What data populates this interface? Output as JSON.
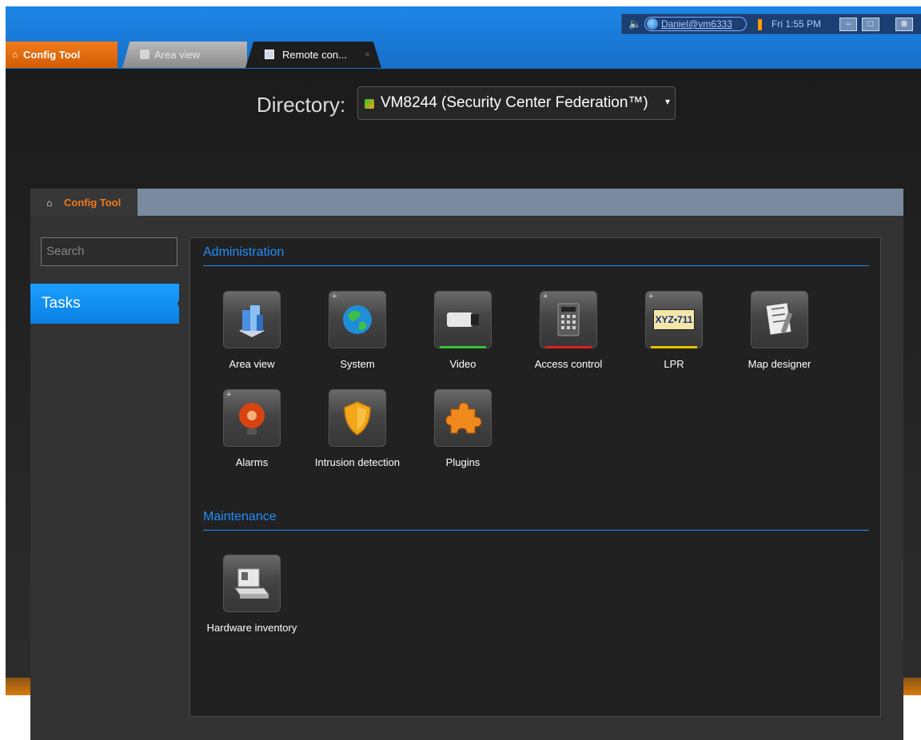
{
  "system_tray": {
    "user": "Daniel@vm6333",
    "time": "Fri 1:55 PM",
    "minimize": "–",
    "maximize": "□",
    "close": "⊗"
  },
  "tabs": [
    {
      "label": "Config Tool"
    },
    {
      "label": "Area view"
    },
    {
      "label": "Remote con...",
      "close": "×"
    }
  ],
  "directory": {
    "label": "Directory:",
    "value": "VM8244 (Security Center Federation™)",
    "caret": "▾"
  },
  "inner_tab": {
    "label": "Config Tool",
    "home_icon": "⌂"
  },
  "sidebar": {
    "search_placeholder": "Search",
    "tasks_label": "Tasks"
  },
  "sections": {
    "administration": {
      "title": "Administration",
      "items": [
        {
          "label": "Area view",
          "icon": "buildings-icon",
          "indicator": null,
          "plus": false
        },
        {
          "label": "System",
          "icon": "globe-icon",
          "indicator": null,
          "plus": true
        },
        {
          "label": "Video",
          "icon": "camera-icon",
          "indicator": "#39c236",
          "plus": false
        },
        {
          "label": "Access control",
          "icon": "keypad-icon",
          "indicator": "#e02020",
          "plus": true
        },
        {
          "label": "LPR",
          "icon": "license-plate-icon",
          "indicator": "#e6c200",
          "plus": true,
          "plate_text": "XYZ•711"
        },
        {
          "label": "Map designer",
          "icon": "map-designer-icon",
          "indicator": null,
          "plus": false
        },
        {
          "label": "Alarms",
          "icon": "alarm-bell-icon",
          "indicator": null,
          "plus": true
        },
        {
          "label": "Intrusion detection",
          "icon": "shield-icon",
          "indicator": null,
          "plus": false
        },
        {
          "label": "Plugins",
          "icon": "puzzle-icon",
          "indicator": null,
          "plus": false
        }
      ]
    },
    "maintenance": {
      "title": "Maintenance",
      "items": [
        {
          "label": "Hardware inventory",
          "icon": "hardware-inventory-icon",
          "indicator": null,
          "plus": false
        }
      ]
    }
  },
  "colors": {
    "accent_orange": "#f07a1a",
    "accent_blue": "#1f8fff",
    "tasks_selected": "#0a7fe4"
  }
}
